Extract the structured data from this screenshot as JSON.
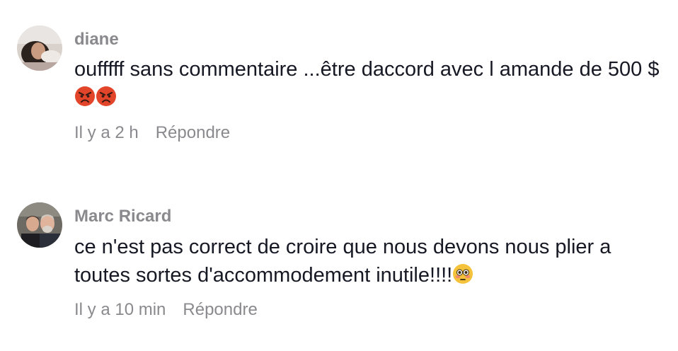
{
  "comments": [
    {
      "username": "diane",
      "text": "oufffff sans commentaire ...être daccord avec l amande de 500 $",
      "emojis": [
        "angry-face-icon",
        "angry-face-icon"
      ],
      "time": "Il y a 2 h",
      "reply_label": "Répondre"
    },
    {
      "username": "Marc Ricard",
      "text": "ce n'est pas correct de croire que nous devons nous plier a toutes sortes d'accommodement inutile!!!!",
      "emojis": [
        "flushed-face-icon"
      ],
      "time": "Il y a 10 min",
      "reply_label": "Répondre"
    }
  ],
  "colors": {
    "username": "#8a8a8e",
    "text": "#161823",
    "meta": "#8a8a8e",
    "angry_emoji": "#e2452a",
    "flushed_emoji": "#f5c33b"
  }
}
